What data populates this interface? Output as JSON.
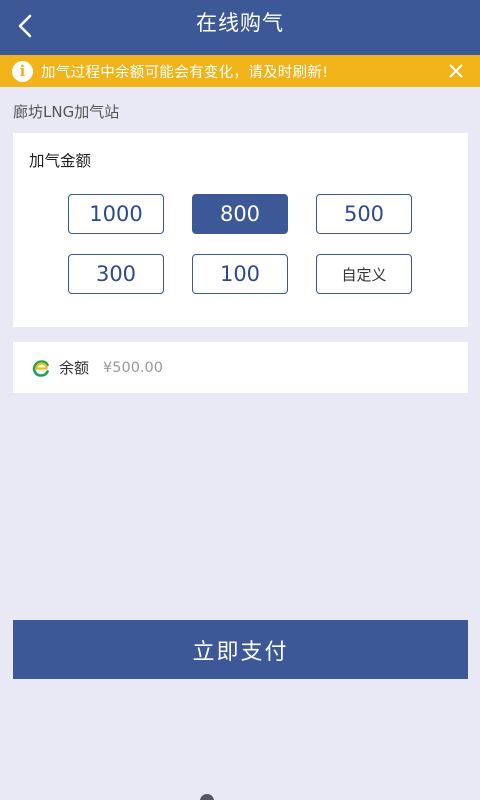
{
  "header": {
    "title": "在线购气"
  },
  "notice": {
    "text": "加气过程中余额可能会有变化，请及时刷新!"
  },
  "station": {
    "name": "廊坊LNG加气站"
  },
  "amount": {
    "label": "加气金额",
    "options": [
      {
        "label": "1000",
        "selected": false
      },
      {
        "label": "800",
        "selected": true
      },
      {
        "label": "500",
        "selected": false
      },
      {
        "label": "300",
        "selected": false
      },
      {
        "label": "100",
        "selected": false
      },
      {
        "label": "自定义",
        "selected": false
      }
    ]
  },
  "balance": {
    "label": "余额",
    "value": "¥500.00"
  },
  "pay": {
    "label": "立即支付"
  },
  "colors": {
    "primary": "#3c5897",
    "notice": "#f0b31a",
    "background": "#e9e9f5"
  },
  "icons": {
    "back": "chevron-left-icon",
    "notice": "info-icon",
    "close": "close-icon",
    "balance": "e-wallet-icon"
  }
}
